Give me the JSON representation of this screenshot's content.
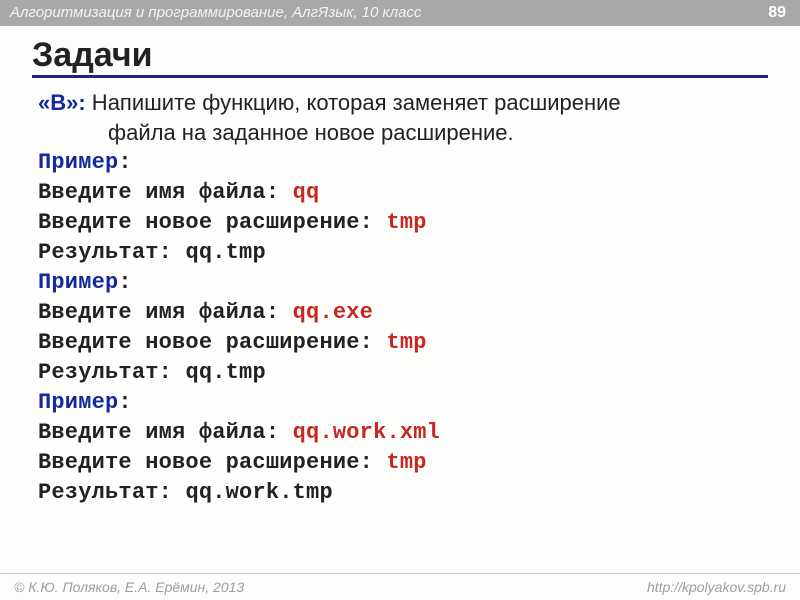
{
  "header": {
    "course": "Алгоритмизация и программирование, АлгЯзык, 10 класс",
    "page": "89"
  },
  "title": "Задачи",
  "task": {
    "label": "«B»:",
    "line1": " Напишите функцию, которая заменяет расширение",
    "line2": "файла на заданное новое расширение."
  },
  "labels": {
    "example": "Пример",
    "colon": ":",
    "enter_name": "Введите имя файла: ",
    "enter_ext": "Введите новое расширение: ",
    "result": "Результат: "
  },
  "ex1": {
    "name": "qq",
    "ext": "tmp",
    "result": "qq.tmp"
  },
  "ex2": {
    "name": "qq.exe",
    "ext": "tmp",
    "result": "qq.tmp"
  },
  "ex3": {
    "name": "qq.work.xml",
    "ext": "tmp",
    "result": "qq.work.tmp"
  },
  "footer": {
    "copyright": "© К.Ю. Поляков, Е.А. Ерёмин, 2013",
    "url": "http://kpolyakov.spb.ru"
  }
}
